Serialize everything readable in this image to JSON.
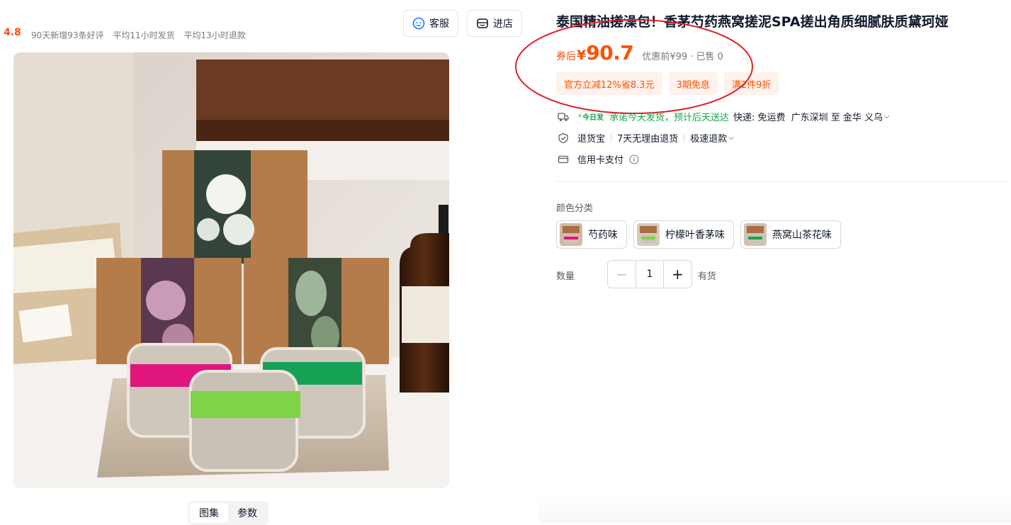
{
  "shop": {
    "rating": "4.8",
    "stats": [
      "90天新增93条好评",
      "平均11小时发货",
      "平均13小时退款"
    ]
  },
  "buttons": {
    "service": "客服",
    "store": "进店"
  },
  "gallery": {
    "tabs": [
      "图集",
      "参数"
    ]
  },
  "product": {
    "title": "泰国精油搓澡包！香茅芍药燕窝搓泥SPA搓出角质细腻肤质黛珂娅",
    "price_label": "券后",
    "currency": "¥",
    "price": "90.7",
    "original": "优惠前¥99 · 已售 0",
    "promos": [
      "官方立减12%省8.3元",
      "3期免息",
      "满2件9折"
    ]
  },
  "shipping": {
    "today_badge": "今日发",
    "promise": "承诺今天发货，预计后天送达",
    "express": "快递: 免运费",
    "route": "广东深圳 至 金华 义乌"
  },
  "returns": {
    "service": "退货宝",
    "policy": "7天无理由退货",
    "fast": "极速退款"
  },
  "payment": {
    "method": "信用卡支付"
  },
  "sku": {
    "label": "颜色分类",
    "options": [
      "芍药味",
      "柠檬叶香茅味",
      "燕窝山茶花味"
    ]
  },
  "quantity": {
    "label": "数量",
    "value": "1",
    "stock": "有货"
  },
  "colors": {
    "accent": "#ff5000",
    "promo_bg": "#fff1eb",
    "green": "#16a34a",
    "annotation": "#e0202a"
  },
  "icons": [
    "service-icon",
    "store-icon",
    "truck-icon",
    "shield-icon",
    "card-icon",
    "info-icon",
    "chevron-down-icon",
    "minus-icon",
    "plus-icon"
  ]
}
